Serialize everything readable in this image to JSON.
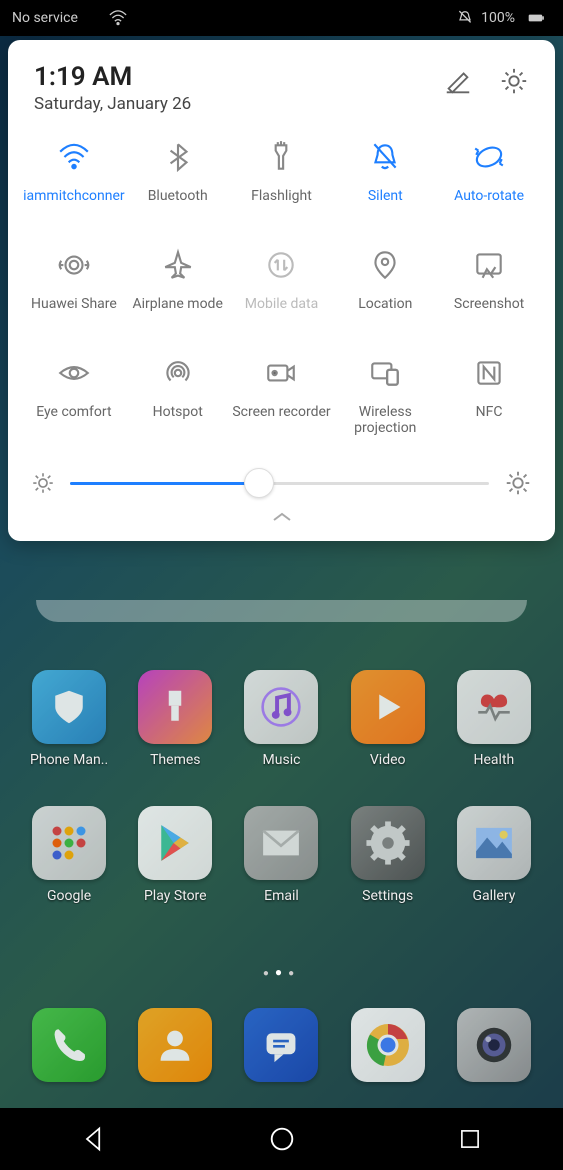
{
  "status": {
    "left_text": "No service",
    "battery_pct": "100%"
  },
  "panel": {
    "time": "1:19 AM",
    "date": "Saturday, January 26",
    "brightness_pct": 45
  },
  "tiles": [
    {
      "label": "iammitchconner",
      "state": "active",
      "icon": "wifi"
    },
    {
      "label": "Bluetooth",
      "state": "off",
      "icon": "bluetooth"
    },
    {
      "label": "Flashlight",
      "state": "off",
      "icon": "flashlight"
    },
    {
      "label": "Silent",
      "state": "active",
      "icon": "silent"
    },
    {
      "label": "Auto-rotate",
      "state": "active",
      "icon": "rotate"
    },
    {
      "label": "Huawei Share",
      "state": "off",
      "icon": "share"
    },
    {
      "label": "Airplane mode",
      "state": "off",
      "icon": "airplane"
    },
    {
      "label": "Mobile data",
      "state": "disabled",
      "icon": "mobiledata"
    },
    {
      "label": "Location",
      "state": "off",
      "icon": "location"
    },
    {
      "label": "Screenshot",
      "state": "off",
      "icon": "screenshot"
    },
    {
      "label": "Eye comfort",
      "state": "off",
      "icon": "eye"
    },
    {
      "label": "Hotspot",
      "state": "off",
      "icon": "hotspot"
    },
    {
      "label": "Screen recorder",
      "state": "off",
      "icon": "recorder"
    },
    {
      "label": "Wireless projection",
      "state": "off",
      "icon": "projection"
    },
    {
      "label": "NFC",
      "state": "off",
      "icon": "nfc"
    }
  ],
  "apps_row1": [
    {
      "label": "Phone Man..",
      "color1": "#4ab8e8",
      "color2": "#2a88c8",
      "glyph": "shield"
    },
    {
      "label": "Themes",
      "color1": "#d040d0",
      "color2": "#ff9040",
      "glyph": "brush"
    },
    {
      "label": "Music",
      "color1": "#f0f0f0",
      "color2": "#d8d8d8",
      "glyph": "music"
    },
    {
      "label": "Video",
      "color1": "#ff9a2a",
      "color2": "#ff7a1a",
      "glyph": "play"
    },
    {
      "label": "Health",
      "color1": "#f0f0f0",
      "color2": "#e0e0e0",
      "glyph": "heart"
    }
  ],
  "apps_row2": [
    {
      "label": "Google",
      "color1": "#e8e8e8",
      "color2": "#d0d0d0",
      "glyph": "folder"
    },
    {
      "label": "Play Store",
      "color1": "#ffffff",
      "color2": "#eeeeee",
      "glyph": "playstore"
    },
    {
      "label": "Email",
      "color1": "#b8b8b8",
      "color2": "#989898",
      "glyph": "mail"
    },
    {
      "label": "Settings",
      "color1": "#888888",
      "color2": "#555555",
      "glyph": "gear"
    },
    {
      "label": "Gallery",
      "color1": "#e8e8e8",
      "color2": "#c8c8c8",
      "glyph": "gallery"
    }
  ],
  "dock": [
    {
      "label": "Phone",
      "color1": "#4ac84a",
      "color2": "#2aa82a",
      "glyph": "phone"
    },
    {
      "label": "Contacts",
      "color1": "#ffb020",
      "color2": "#ff9000",
      "glyph": "contact"
    },
    {
      "label": "Messages",
      "color1": "#2a68d8",
      "color2": "#1a48b8",
      "glyph": "msg"
    },
    {
      "label": "Chrome",
      "color1": "#ffffff",
      "color2": "#eeeeee",
      "glyph": "chrome"
    },
    {
      "label": "Camera",
      "color1": "#c8c8c8",
      "color2": "#989898",
      "glyph": "camera"
    }
  ]
}
